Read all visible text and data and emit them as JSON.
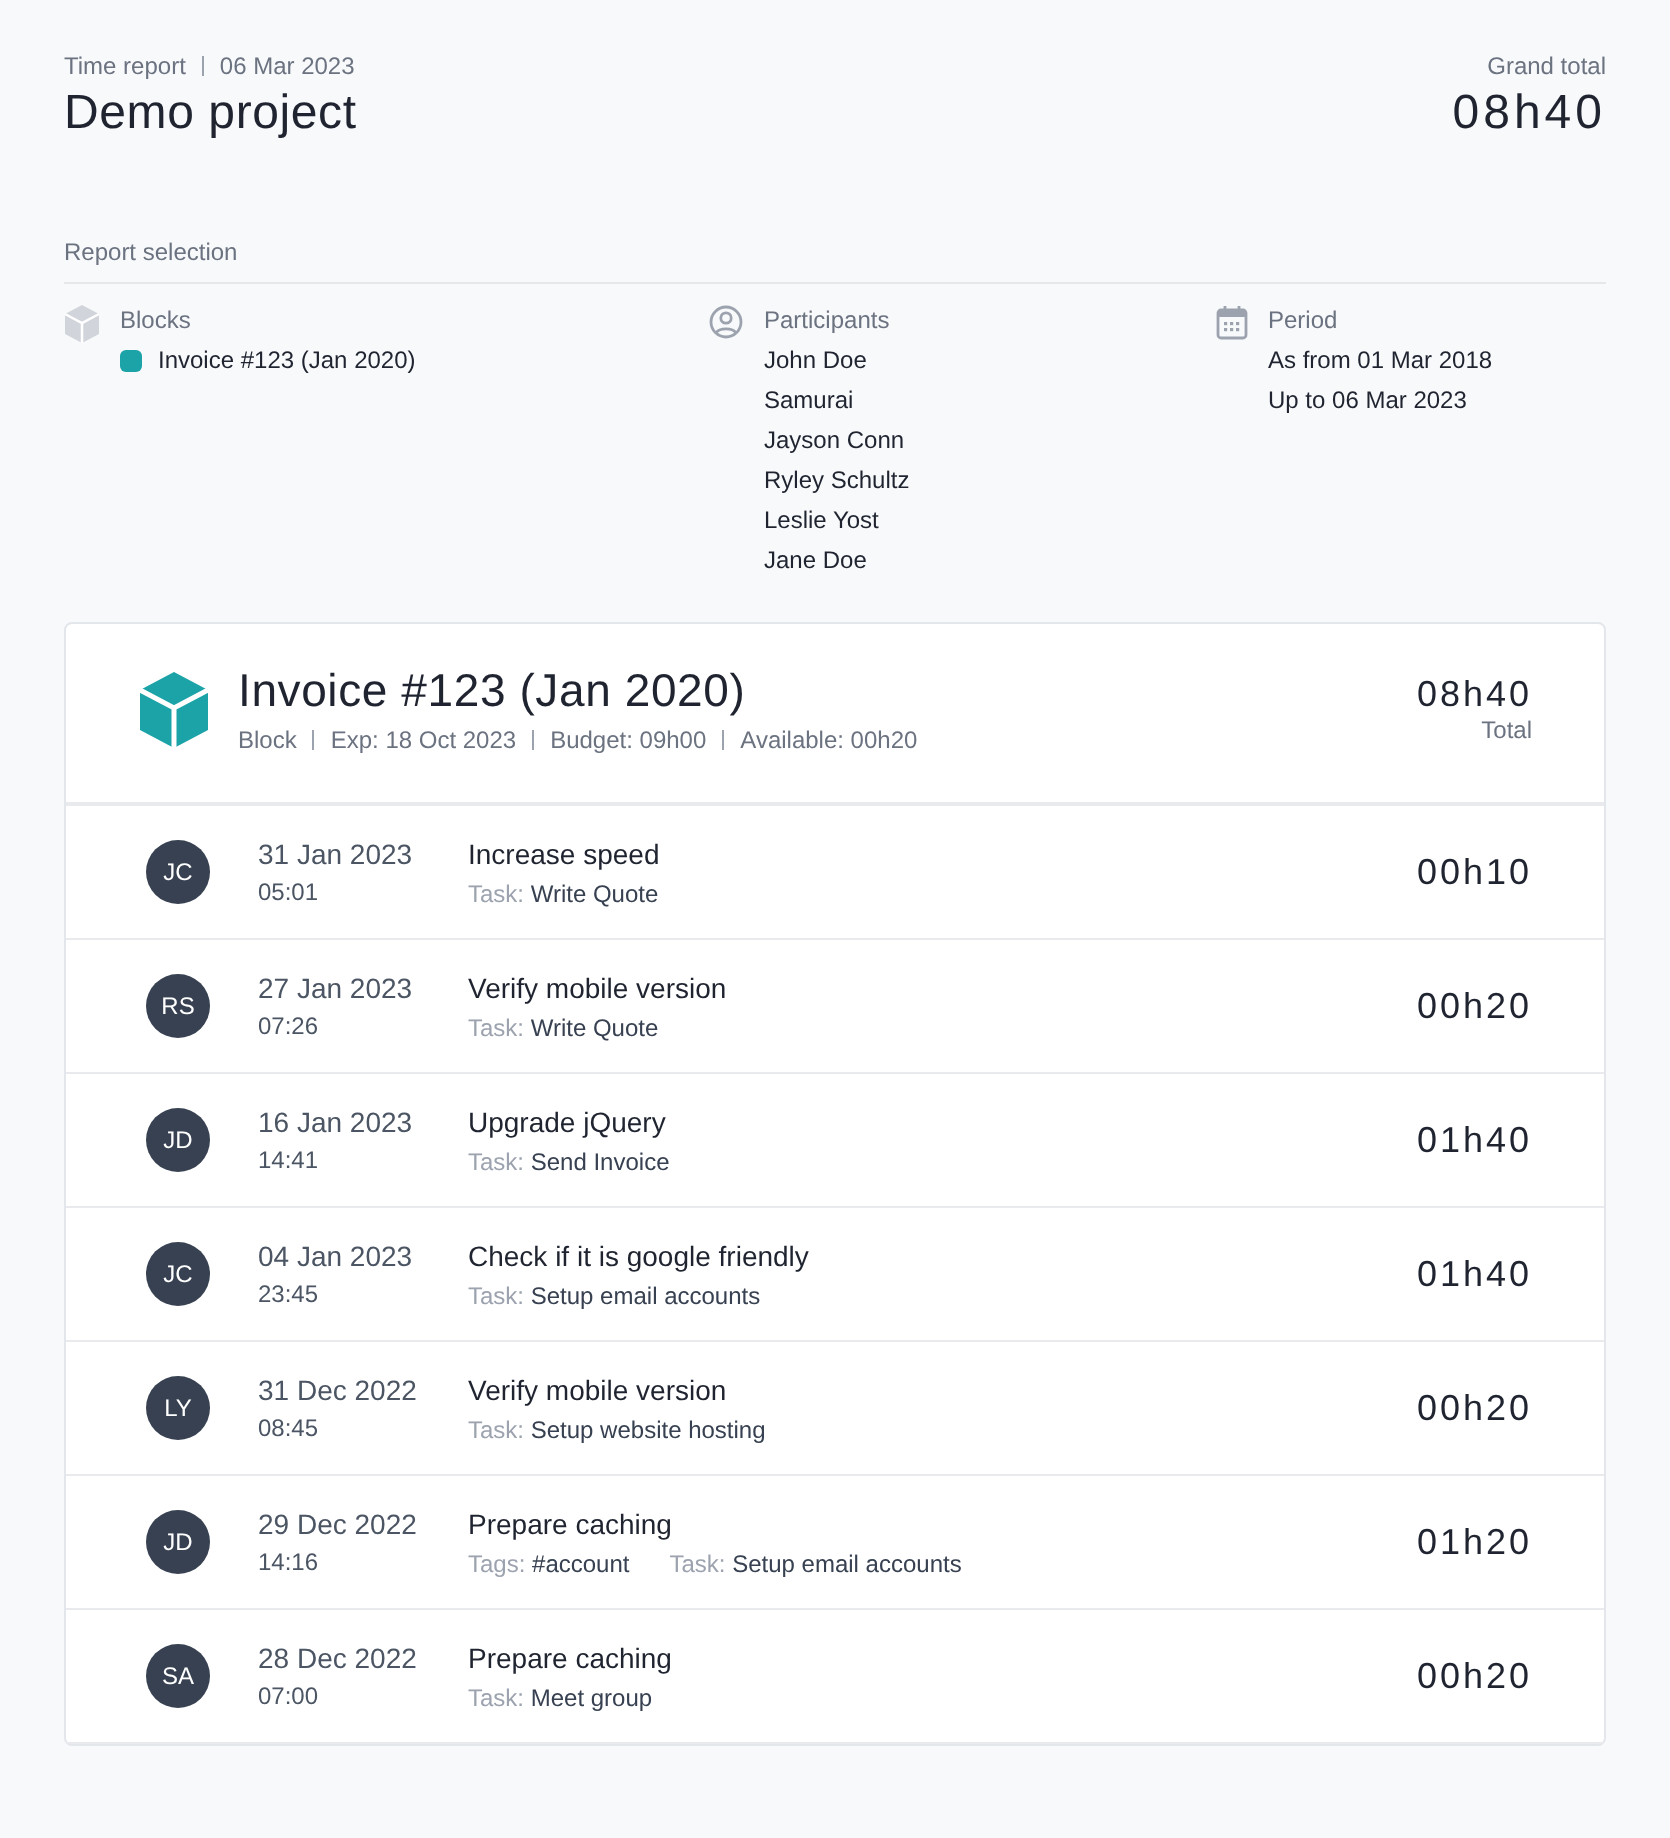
{
  "header": {
    "kind_label": "Time report",
    "date": "06 Mar 2023",
    "title": "Demo project",
    "total_label": "Grand total",
    "total": "08h40"
  },
  "selection": {
    "title": "Report selection",
    "blocks": {
      "label": "Blocks",
      "items": [
        {
          "name": "Invoice #123 (Jan 2020)",
          "color": "#1ba3a8"
        }
      ]
    },
    "participants": {
      "label": "Participants",
      "items": [
        "John Doe",
        "Samurai",
        "Jayson Conn",
        "Ryley Schultz",
        "Leslie Yost",
        "Jane Doe"
      ]
    },
    "period": {
      "label": "Period",
      "items": [
        "As from 01 Mar 2018",
        "Up to 06 Mar 2023"
      ]
    }
  },
  "block": {
    "title": "Invoice #123 (Jan 2020)",
    "meta": [
      "Block",
      "Exp: 18 Oct 2023",
      "Budget: 09h00",
      "Available: 00h20"
    ],
    "total": "08h40",
    "total_label": "Total",
    "entries": [
      {
        "initials": "JC",
        "date": "31 Jan 2023",
        "time": "05:01",
        "title": "Increase speed",
        "details": [
          {
            "label": "Task:",
            "value": "Write Quote"
          }
        ],
        "duration": "00h10"
      },
      {
        "initials": "RS",
        "date": "27 Jan 2023",
        "time": "07:26",
        "title": "Verify mobile version",
        "details": [
          {
            "label": "Task:",
            "value": "Write Quote"
          }
        ],
        "duration": "00h20"
      },
      {
        "initials": "JD",
        "date": "16 Jan 2023",
        "time": "14:41",
        "title": "Upgrade jQuery",
        "details": [
          {
            "label": "Task:",
            "value": "Send Invoice"
          }
        ],
        "duration": "01h40"
      },
      {
        "initials": "JC",
        "date": "04 Jan 2023",
        "time": "23:45",
        "title": "Check if it is google friendly",
        "details": [
          {
            "label": "Task:",
            "value": "Setup email accounts"
          }
        ],
        "duration": "01h40"
      },
      {
        "initials": "LY",
        "date": "31 Dec 2022",
        "time": "08:45",
        "title": "Verify mobile version",
        "details": [
          {
            "label": "Task:",
            "value": "Setup website hosting"
          }
        ],
        "duration": "00h20"
      },
      {
        "initials": "JD",
        "date": "29 Dec 2022",
        "time": "14:16",
        "title": "Prepare caching",
        "details": [
          {
            "label": "Tags:",
            "value": "#account"
          },
          {
            "label": "Task:",
            "value": "Setup email accounts"
          }
        ],
        "duration": "01h20"
      },
      {
        "initials": "SA",
        "date": "28 Dec 2022",
        "time": "07:00",
        "title": "Prepare caching",
        "details": [
          {
            "label": "Task:",
            "value": "Meet group"
          }
        ],
        "duration": "00h20"
      }
    ]
  }
}
